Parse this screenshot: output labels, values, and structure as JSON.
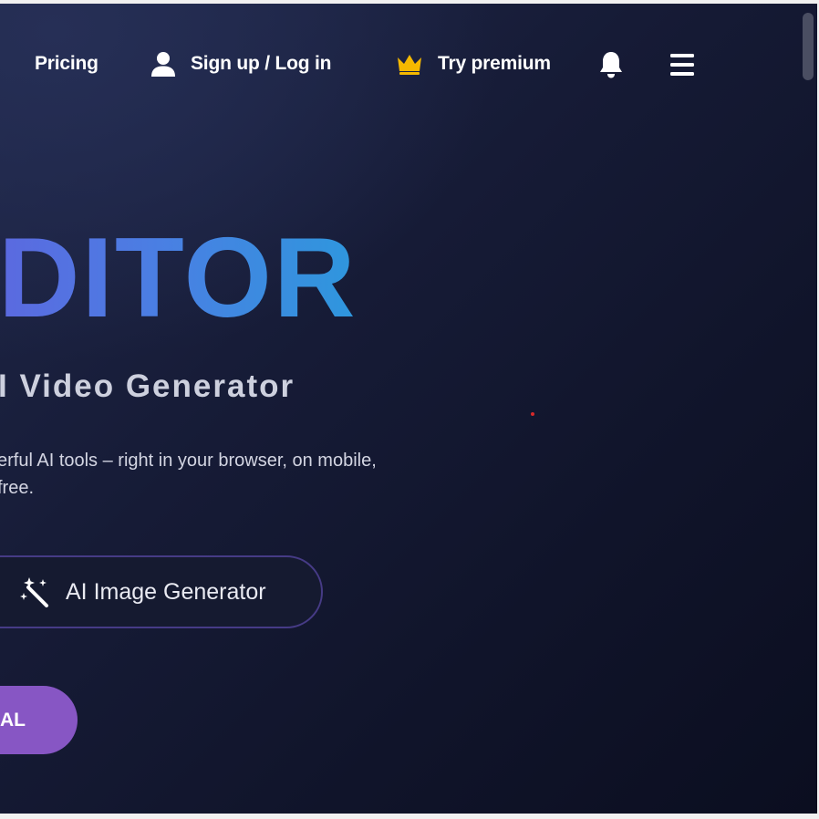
{
  "nav": {
    "pricing": "Pricing",
    "login": "Sign up / Log in",
    "premium": "Try premium",
    "icons": {
      "user": "user-icon",
      "crown": "crown-icon",
      "bell": "bell-icon",
      "menu": "hamburger-menu-icon"
    }
  },
  "hero": {
    "headline": "DITOR",
    "subhead": "I Video Generator",
    "description": [
      "erful AI tools – right in your browser, on mobile,",
      " free."
    ]
  },
  "buttons": {
    "ai_image": "AI Image Generator",
    "cta": "AL"
  },
  "colors": {
    "background": "#161b36",
    "headline_start": "#5b69e0",
    "headline_end": "#2e97dd",
    "crown": "#f5b800",
    "cta": "#8756c4",
    "ai_button_border": "#463b86"
  }
}
